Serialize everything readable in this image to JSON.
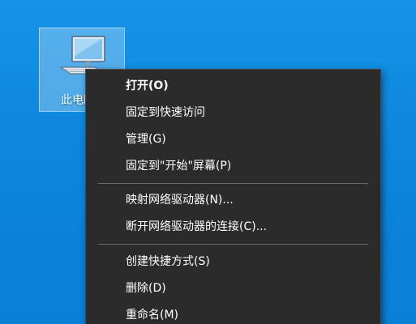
{
  "desktop": {
    "icon": {
      "label": "此电脑",
      "icon_name": "computer-icon"
    }
  },
  "context_menu": {
    "items": [
      {
        "label": "打开(O)",
        "default": true
      },
      {
        "label": "固定到快速访问"
      },
      {
        "label": "管理(G)"
      },
      {
        "label": "固定到\"开始\"屏幕(P)"
      },
      {
        "label": "映射网络驱动器(N)..."
      },
      {
        "label": "断开网络驱动器的连接(C)..."
      },
      {
        "label": "创建快捷方式(S)"
      },
      {
        "label": "删除(D)"
      },
      {
        "label": "重命名(M)"
      }
    ]
  },
  "colors": {
    "desktop_background": "#0d86dc",
    "menu_background": "#2b2b2b",
    "menu_text": "#ffffff",
    "separator": "#6a6a6a"
  }
}
